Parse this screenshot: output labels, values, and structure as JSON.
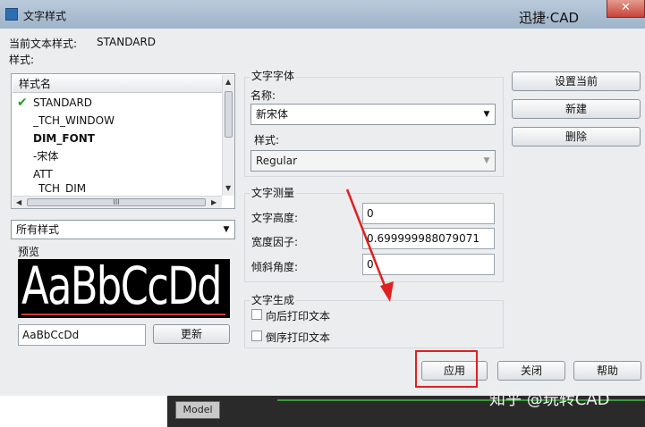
{
  "window": {
    "title": "文字样式",
    "brand": "迅捷·CAD",
    "close_glyph": "✕"
  },
  "current_style": {
    "label": "当前文本样式:",
    "value": "STANDARD"
  },
  "styles_label": "样式:",
  "style_list": {
    "header": "样式名",
    "items": [
      {
        "label": "STANDARD",
        "bold": false,
        "checked": true
      },
      {
        "label": "_TCH_WINDOW",
        "bold": false,
        "checked": false
      },
      {
        "label": "DIM_FONT",
        "bold": true,
        "checked": false
      },
      {
        "label": "-宋体",
        "bold": false,
        "checked": false
      },
      {
        "label": "ATT",
        "bold": false,
        "checked": false
      },
      {
        "label": "_TCH_DIM",
        "bold": false,
        "checked": false
      }
    ],
    "scroll_grip": "III"
  },
  "filter": {
    "value": "所有样式"
  },
  "preview": {
    "label": "预览",
    "sample": "AaBbCcDd",
    "input_value": "AaBbCcDd",
    "update_button": "更新"
  },
  "font": {
    "group_label": "文字字体",
    "name_label": "名称:",
    "name_value": "新宋体",
    "style_label": "样式:",
    "style_value": "Regular"
  },
  "measure": {
    "group_label": "文字测量",
    "height_label": "文字高度:",
    "height_value": "0",
    "width_label": "宽度因子:",
    "width_value": "0.699999988079071",
    "oblique_label": "倾斜角度:",
    "oblique_value": "0"
  },
  "generate": {
    "group_label": "文字生成",
    "backwards_label": "向后打印文本",
    "upside_label": "倒序打印文本"
  },
  "side_buttons": {
    "set_current": "设置当前",
    "new": "新建",
    "delete": "删除"
  },
  "bottom_buttons": {
    "apply": "应用",
    "close": "关闭",
    "help": "帮助"
  },
  "taskbar": {
    "model_tab": "Model"
  },
  "watermark": "知乎 @玩转CAD",
  "colors": {
    "annotation_red": "#e02020",
    "check_green": "#2a9a2a"
  }
}
